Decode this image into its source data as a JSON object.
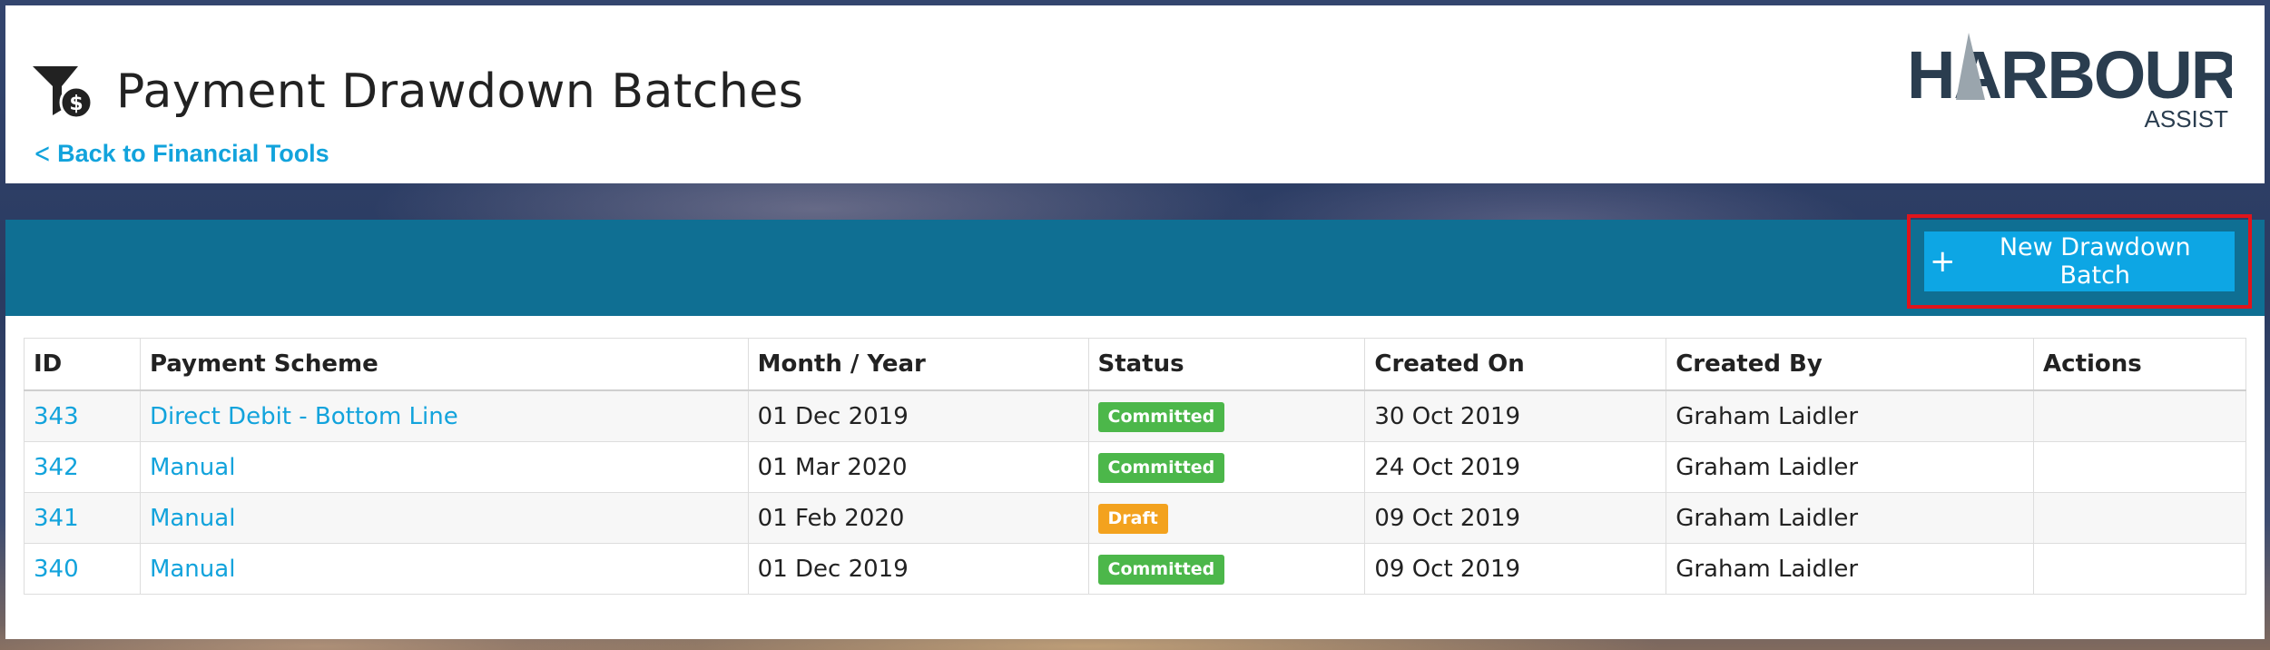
{
  "header": {
    "title": "Payment Drawdown Batches",
    "back_link": "Back to Financial Tools",
    "title_icon": "funnel-dollar-icon",
    "logo": {
      "main": "HARBOUR",
      "sub": "ASSIST"
    }
  },
  "toolbar": {
    "new_batch_label": "New Drawdown Batch",
    "new_batch_icon": "plus-icon"
  },
  "table": {
    "columns": [
      "ID",
      "Payment Scheme",
      "Month / Year",
      "Status",
      "Created On",
      "Created By",
      "Actions"
    ],
    "rows": [
      {
        "id": "343",
        "scheme": "Direct Debit - Bottom Line",
        "month_year": "01 Dec 2019",
        "status": "Committed",
        "created_on": "30 Oct 2019",
        "created_by": "Graham Laidler",
        "actions": ""
      },
      {
        "id": "342",
        "scheme": "Manual",
        "month_year": "01 Mar 2020",
        "status": "Committed",
        "created_on": "24 Oct 2019",
        "created_by": "Graham Laidler",
        "actions": ""
      },
      {
        "id": "341",
        "scheme": "Manual",
        "month_year": "01 Feb 2020",
        "status": "Draft",
        "created_on": "09 Oct 2019",
        "created_by": "Graham Laidler",
        "actions": ""
      },
      {
        "id": "340",
        "scheme": "Manual",
        "month_year": "01 Dec 2019",
        "status": "Committed",
        "created_on": "09 Oct 2019",
        "created_by": "Graham Laidler",
        "actions": ""
      }
    ]
  },
  "colors": {
    "accent": "#12a3dc",
    "toolbar": "#0f6f93",
    "button": "#0da6e4",
    "highlight": "#e0141b",
    "committed": "#4cb74a",
    "draft": "#f3a21e"
  }
}
